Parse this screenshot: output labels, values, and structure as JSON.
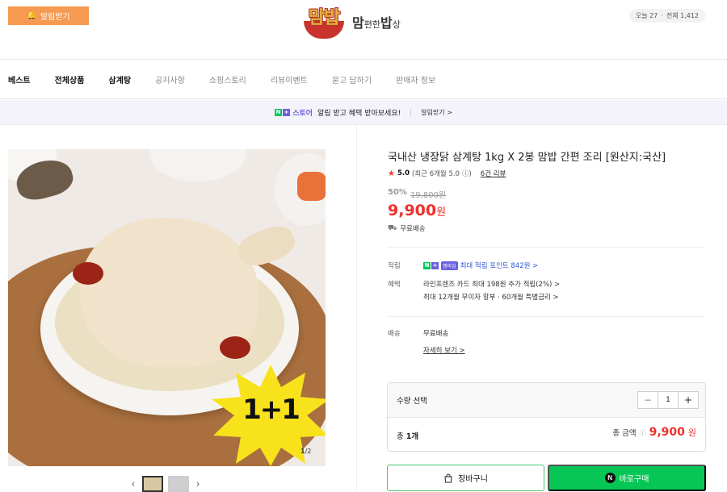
{
  "header": {
    "alarm_button": "알림받기",
    "logo_mark": "맘밥",
    "logo_text_1": "맘",
    "logo_text_2": "편한",
    "logo_text_3": "밥",
    "logo_text_4": "상",
    "visitors_today": "오늘 27",
    "visitors_sep": "·",
    "visitors_total": "전체 1,412"
  },
  "nav": {
    "items": [
      "베스트",
      "전체상품",
      "삼계탕",
      "공지사항",
      "쇼핑스토리",
      "리뷰이벤트",
      "묻고 답하기",
      "판매자 정보"
    ]
  },
  "banner": {
    "n": "N",
    "plus": "+",
    "store": "스토어",
    "message": "알림 받고 혜택 받아보세요!",
    "link": "알림받기 >"
  },
  "gallery": {
    "badge": "1+1",
    "page_current": "1",
    "page_total": "/2",
    "prev": "‹",
    "next": "›"
  },
  "product": {
    "title": "국내산 냉장닭 삼계탕 1kg X 2봉 맘밥 간편 조리 [원산지:국산]",
    "rating_star": "★",
    "rating_score": "5.0",
    "rating_note": "(최근 6개월 5.0",
    "rating_info": "ⓘ)",
    "review_count": "6건 리뷰",
    "discount_rate": "50%",
    "original_price": "19,800원",
    "price": "9,900",
    "price_unit": "원",
    "shipping": "무료배송"
  },
  "details": {
    "points_label": "적립",
    "points_badge_n": "N",
    "points_badge_plus": "+",
    "points_badge": "멤버십",
    "points_text": "최대 적립 포인트 842원 >",
    "benefit_label": "혜택",
    "benefit_1": "라인프렌즈 카드 최대 198원 추가 적립(2%) >",
    "benefit_2": "최대 12개월 무이자 할부 · 60개월 특별금리 >",
    "delivery_label": "배송",
    "delivery_value": "무료배송",
    "delivery_link": "자세히 보기 >"
  },
  "order": {
    "qty_label": "수량 선택",
    "minus": "−",
    "qty": "1",
    "plus": "+",
    "total_count_prefix": "총",
    "total_count": "1개",
    "total_label": "총 금액",
    "total_info": "ⓘ",
    "total_price": "9,900",
    "total_unit": "원",
    "cart_button": "장바구니",
    "buy_n": "N",
    "buy_button": "바로구매"
  },
  "colors": {
    "accent_orange": "#f59a50",
    "price_red": "#f0302a",
    "naver_green": "#06c755",
    "naver_purple": "#6a5fe0"
  }
}
